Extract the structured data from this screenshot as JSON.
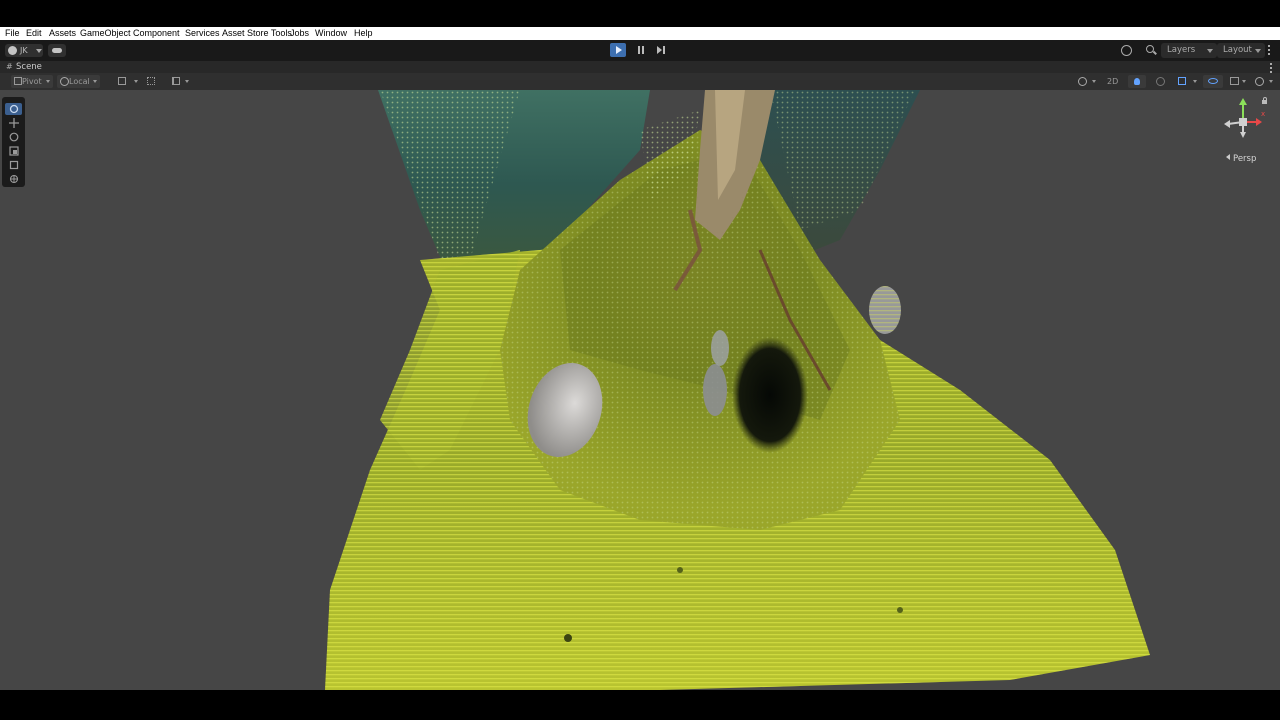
{
  "menu": [
    "File",
    "Edit",
    "Assets",
    "GameObject",
    "Component",
    "Services",
    "Asset Store Tools",
    "Jobs",
    "Window",
    "Help"
  ],
  "toolbar": {
    "account_label": "JK",
    "playing": true,
    "layers_label": "Layers",
    "layout_label": "Layout",
    "accent_color": "#3d6fb0"
  },
  "scene_tab": {
    "title": "Scene"
  },
  "scene_toolbar": {
    "pivot_label": "Pivot",
    "local_label": "Local",
    "mode_2d_label": "2D"
  },
  "tools": [
    "view-tool",
    "move-tool",
    "rotate-tool",
    "scale-tool",
    "rect-tool",
    "transform-tool"
  ],
  "selected_tool": "view-tool",
  "gizmo": {
    "projection_label": "Persp",
    "axis_label_x": "x"
  },
  "viewport": {
    "content": "point-cloud",
    "background": "#464646"
  }
}
